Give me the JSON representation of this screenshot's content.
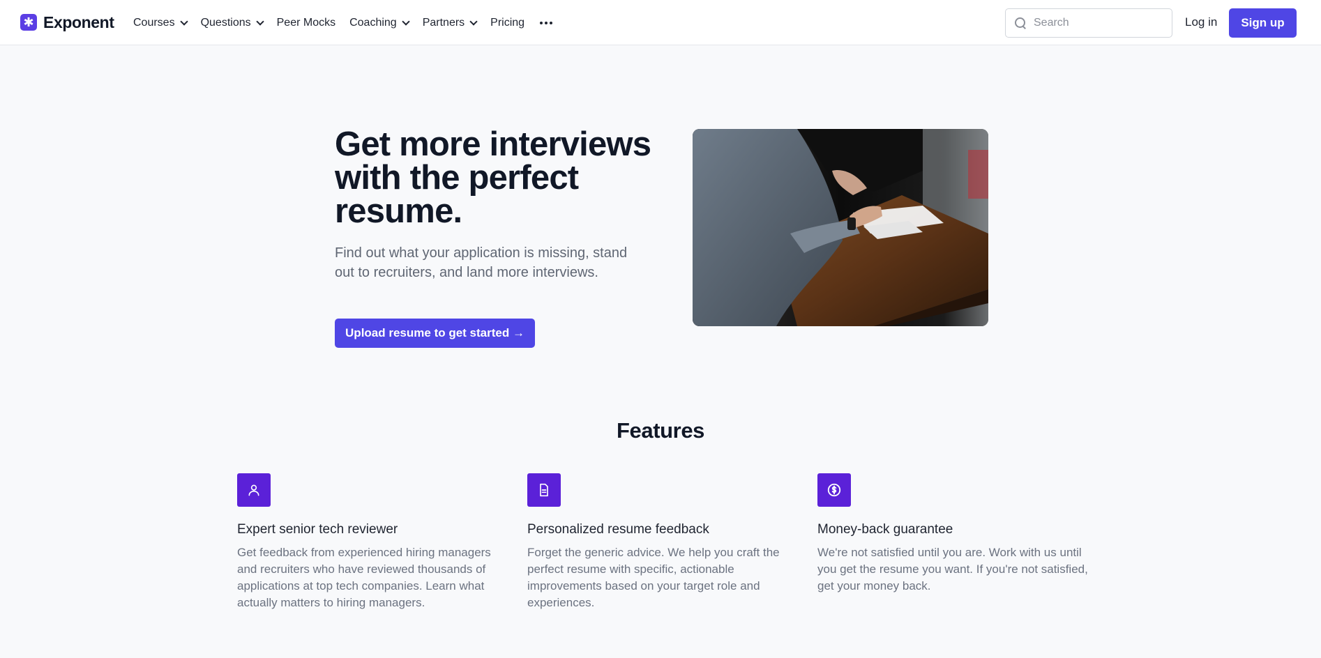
{
  "brand": {
    "name": "Exponent",
    "logo_glyph": "✱",
    "accent_color": "#4f46e5",
    "icon_bg_color": "#5b21d8"
  },
  "nav": {
    "items": [
      {
        "label": "Courses",
        "has_dropdown": true
      },
      {
        "label": "Questions",
        "has_dropdown": true
      },
      {
        "label": "Peer Mocks",
        "has_dropdown": false
      },
      {
        "label": "Coaching",
        "has_dropdown": true
      },
      {
        "label": "Partners",
        "has_dropdown": true
      },
      {
        "label": "Pricing",
        "has_dropdown": false
      }
    ],
    "more_icon": "more-horizontal-icon"
  },
  "search": {
    "placeholder": "Search",
    "value": ""
  },
  "auth": {
    "login_label": "Log in",
    "signup_label": "Sign up"
  },
  "hero": {
    "title": "Get more interviews with the perfect resume.",
    "subtitle": "Find out what your application is missing, stand out to recruiters, and land more interviews.",
    "cta_label": "Upload resume to get started →",
    "image_alt": "Two people reviewing a resume at a wooden table"
  },
  "features": {
    "title": "Features",
    "items": [
      {
        "icon": "user-icon",
        "title": "Expert senior tech reviewer",
        "description": "Get feedback from experienced hiring managers and recruiters who have reviewed thousands of applications at top tech companies. Learn what actually matters to hiring managers."
      },
      {
        "icon": "document-icon",
        "title": "Personalized resume feedback",
        "description": "Forget the generic advice. We help you craft the perfect resume with specific, actionable improvements based on your target role and experiences."
      },
      {
        "icon": "dollar-circle-icon",
        "title": "Money-back guarantee",
        "description": "We're not satisfied until you are. Work with us until you get the resume you want. If you're not satisfied, get your money back."
      }
    ]
  }
}
